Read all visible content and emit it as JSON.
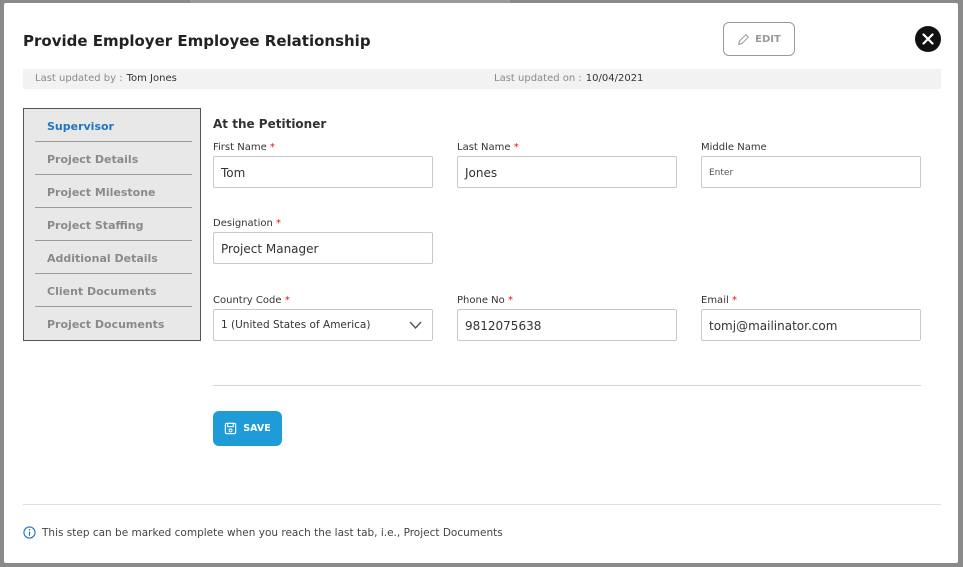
{
  "modal": {
    "title": "Provide Employer Employee Relationship",
    "edit_label": "EDIT",
    "close_icon": "close-icon"
  },
  "meta": {
    "updated_by_label": "Last updated by :",
    "updated_by_value": "Tom Jones",
    "updated_on_label": "Last updated on :",
    "updated_on_value": "10/04/2021"
  },
  "sidebar": {
    "items": [
      {
        "label": "Supervisor",
        "active": true
      },
      {
        "label": "Project Details",
        "active": false
      },
      {
        "label": "Project Milestone",
        "active": false
      },
      {
        "label": "Project Staffing",
        "active": false
      },
      {
        "label": "Additional Details",
        "active": false
      },
      {
        "label": "Client Documents",
        "active": false
      },
      {
        "label": "Project Documents",
        "active": false
      }
    ]
  },
  "form": {
    "section_title": "At the Petitioner",
    "first_name": {
      "label": "First Name",
      "value": "Tom"
    },
    "last_name": {
      "label": "Last Name",
      "value": "Jones"
    },
    "middle_name": {
      "label": "Middle Name",
      "placeholder": "Enter"
    },
    "designation": {
      "label": "Designation",
      "value": "Project Manager"
    },
    "country_code": {
      "label": "Country Code",
      "value": "1 (United States of America)"
    },
    "phone": {
      "label": "Phone No",
      "value": "9812075638"
    },
    "email": {
      "label": "Email",
      "value": "tomj@mailinator.com"
    },
    "required_mark": "*",
    "save_label": "SAVE"
  },
  "footer": {
    "note": "This step can be marked complete when you reach the last tab, i.e., Project Documents"
  },
  "colors": {
    "accent": "#1f74c6",
    "save_button": "#1f9bd7",
    "required": "#dd1111"
  }
}
